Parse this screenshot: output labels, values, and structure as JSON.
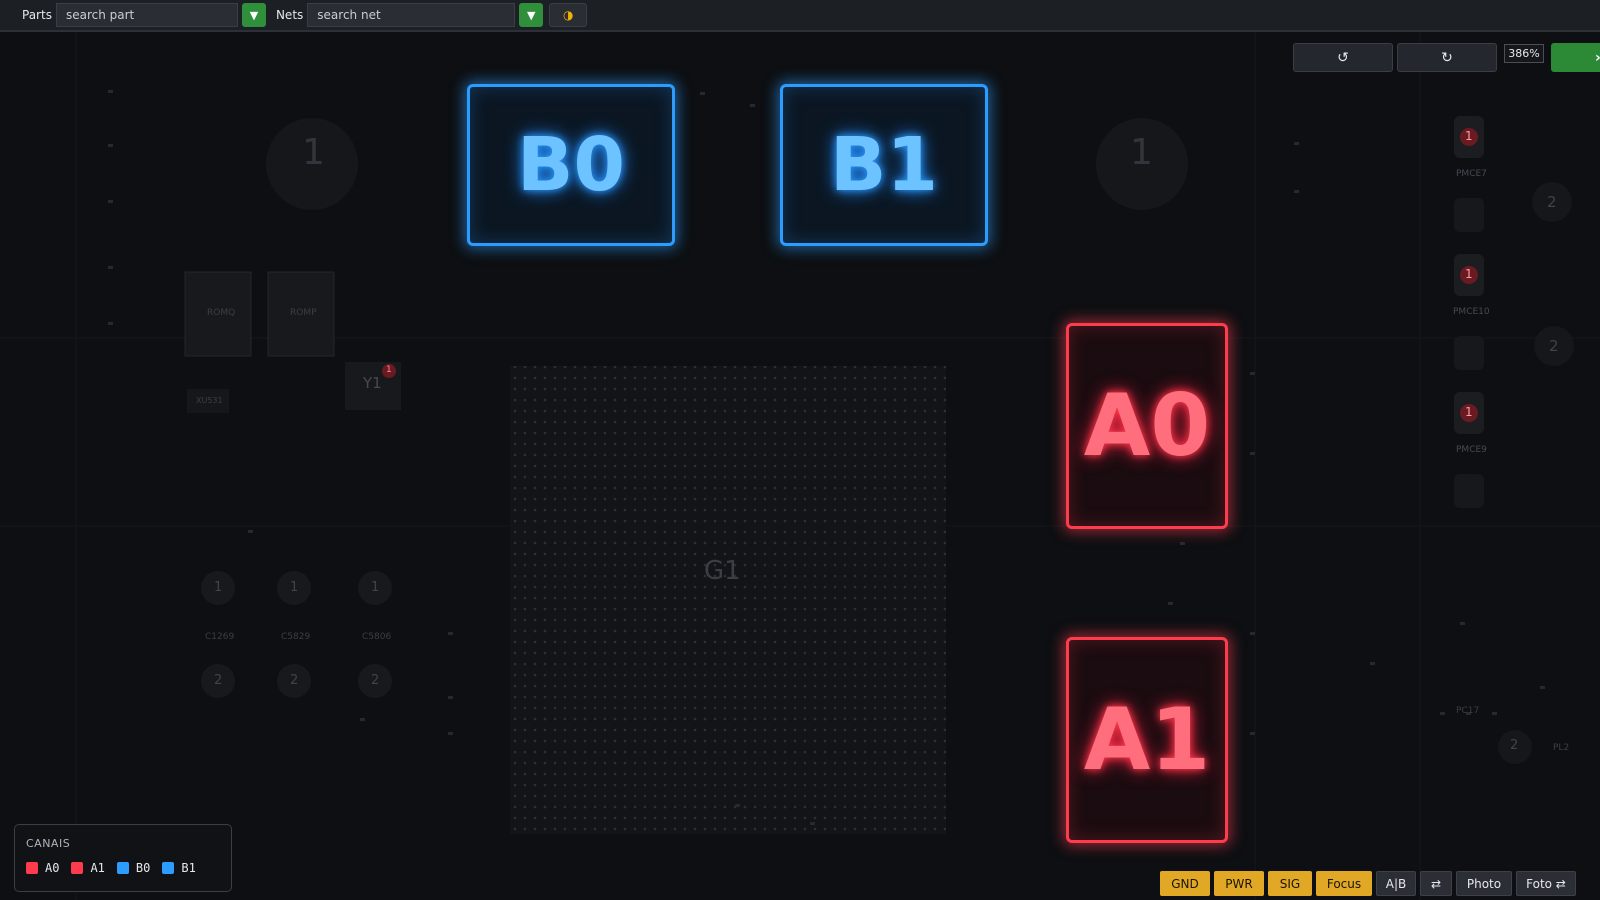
{
  "toolbar": {
    "parts_label": "Parts",
    "parts_placeholder": "search part",
    "nets_label": "Nets",
    "nets_placeholder": "search net",
    "dropdown_icon": "chevron-down-icon",
    "theme_icon": "half-moon-icon"
  },
  "view": {
    "rotate_left_icon": "rotate-ccw-icon",
    "rotate_right_icon": "rotate-cw-icon",
    "rotate_left_glyph": "↺",
    "rotate_right_glyph": "↻",
    "zoom": "386%",
    "go_glyph": "›"
  },
  "channels": {
    "b0": "B0",
    "b1": "B1",
    "a0": "A0",
    "a1": "A1",
    "blue_color": "#2d9cff",
    "red_color": "#ff3b4e"
  },
  "board": {
    "g1": "G1",
    "ho3": "1",
    "ho1": "1",
    "rom_left": "ROMQ",
    "rom_right": "ROMP",
    "y1": "Y1",
    "y1_pin": "1",
    "xu531": "XU531",
    "pad_labels": [
      "C1269",
      "C5829",
      "C5806"
    ],
    "pad_top": "1",
    "pad_bottom": "2",
    "pmce7": "PMCE7",
    "pmce10": "PMCE10",
    "pmce9": "PMCE9",
    "right_pin1": "1",
    "right_pin2": "2",
    "pc17": "PC17",
    "pl2": "PL2"
  },
  "legend": {
    "title": "CANAIS",
    "items": [
      {
        "label": "A0",
        "color": "#ff3b4e"
      },
      {
        "label": "A1",
        "color": "#ff3b4e"
      },
      {
        "label": "B0",
        "color": "#2d9cff"
      },
      {
        "label": "B1",
        "color": "#2d9cff"
      }
    ]
  },
  "buttons": {
    "gnd": "GND",
    "pwr": "PWR",
    "sig": "SIG",
    "focus": "Focus",
    "ab": "A|B",
    "swap": "⇄",
    "photo": "Photo",
    "foto": "Foto ⇄",
    "accent": "#e0a824"
  }
}
